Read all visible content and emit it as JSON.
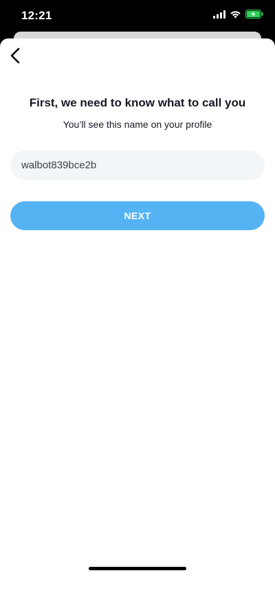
{
  "status_bar": {
    "time": "12:21",
    "icons": [
      "cellular-signal-icon",
      "wifi-icon",
      "battery-charging-icon"
    ],
    "battery_color": "#30d158"
  },
  "header": {
    "back_icon": "chevron-left-icon"
  },
  "main": {
    "title": "First, we need to know what to call you",
    "subtitle": "You’ll see this name on your profile",
    "name_input": {
      "value": "walbot839bce2b",
      "placeholder": ""
    },
    "next_button": {
      "label": "NEXT",
      "color": "#55b3f3"
    }
  }
}
